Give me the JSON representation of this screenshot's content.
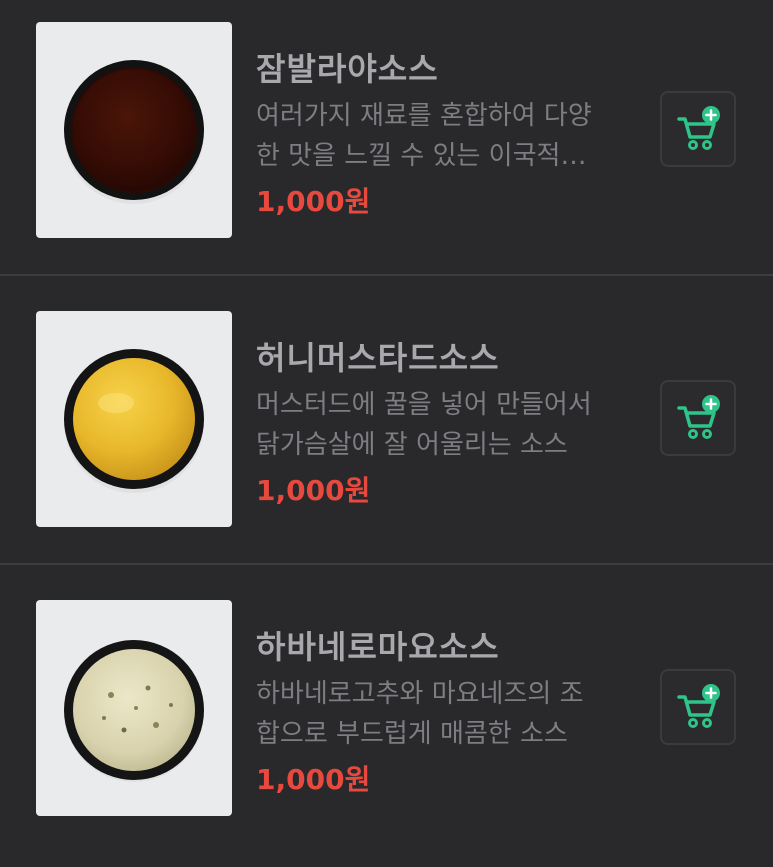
{
  "menu": {
    "items": [
      {
        "name": "잠발라야소스",
        "description_lines": [
          "여러가지 재료를 혼합하여 다양",
          "한 맛을 느낄 수 있는 이국적…"
        ],
        "price": "1,000원",
        "sauce_color": "#3a0f06",
        "cart_icon": "cart-add-icon"
      },
      {
        "name": "허니머스타드소스",
        "description_lines": [
          "머스터드에 꿀을 넣어 만들어서",
          "닭가슴살에 잘 어울리는 소스"
        ],
        "price": "1,000원",
        "sauce_color": "#e8b72a",
        "cart_icon": "cart-add-icon"
      },
      {
        "name": "하바네로마요소스",
        "description_lines": [
          "하바네로고추와 마요네즈의 조",
          "합으로 부드럽게 매콤한 소스"
        ],
        "price": "1,000원",
        "sauce_color": "#d8d2ad",
        "cart_icon": "cart-add-icon"
      }
    ]
  },
  "colors": {
    "background": "#29292b",
    "accent_green": "#2fc489",
    "price_red": "#e8493f"
  }
}
